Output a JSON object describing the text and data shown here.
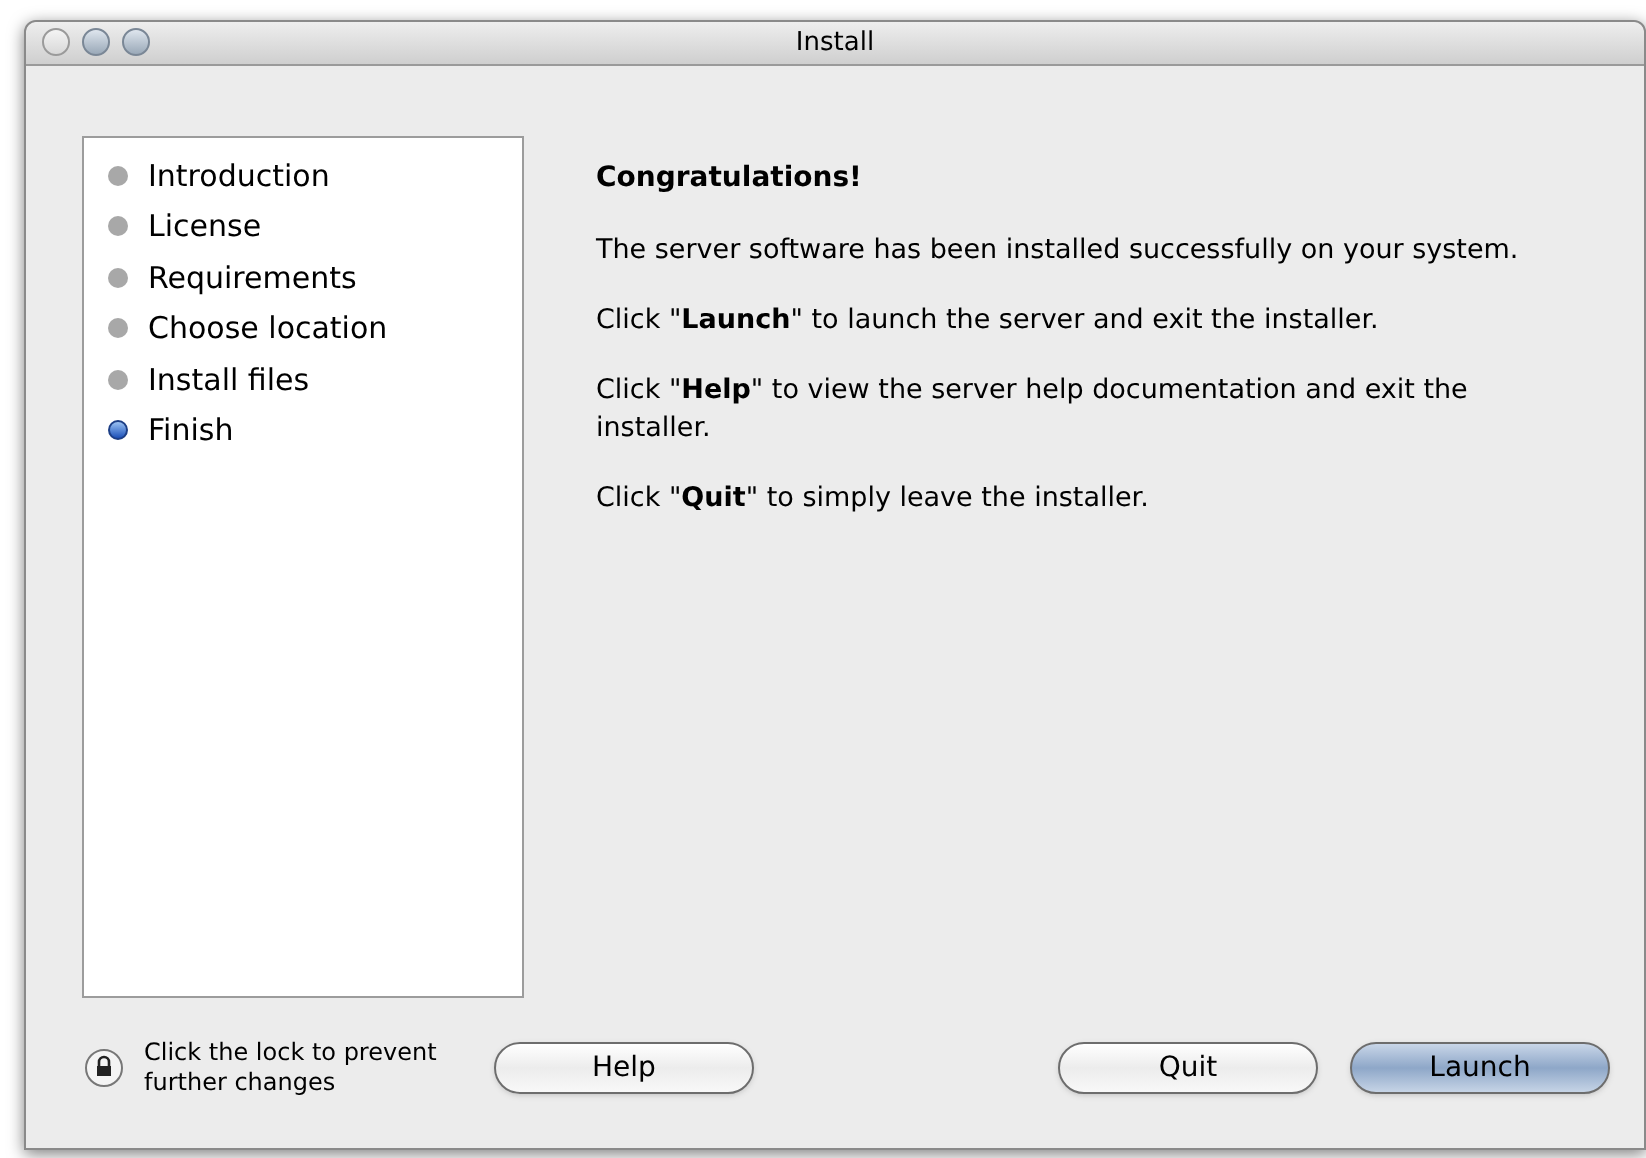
{
  "window": {
    "title": "Install"
  },
  "steps": [
    {
      "label": "Introduction",
      "selected": false
    },
    {
      "label": "License",
      "selected": false
    },
    {
      "label": "Requirements",
      "selected": false
    },
    {
      "label": "Choose location",
      "selected": false
    },
    {
      "label": "Install files",
      "selected": false
    },
    {
      "label": "Finish",
      "selected": true
    }
  ],
  "content": {
    "heading": "Congratulations!",
    "paragraphs": [
      "The server software has been installed successfully on your system.",
      "Click \"**Launch**\" to launch the server and exit the installer.",
      "Click \"**Help**\" to view the server help documentation and exit the installer.",
      "Click \"**Quit**\" to simply leave the installer."
    ]
  },
  "lock": {
    "text": "Click the lock to prevent further changes"
  },
  "buttons": [
    {
      "label": "Help",
      "kind": "normal"
    },
    {
      "label": "Quit",
      "kind": "normal"
    },
    {
      "label": "Launch",
      "kind": "default"
    }
  ]
}
